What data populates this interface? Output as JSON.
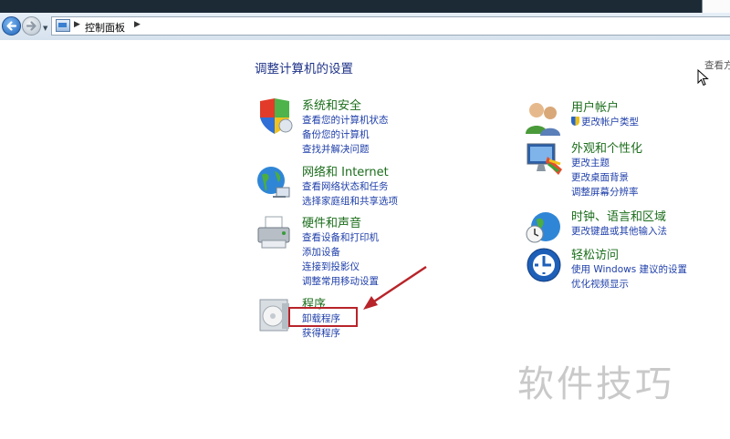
{
  "window": {
    "breadcrumb": "控制面板"
  },
  "main": {
    "heading": "调整计算机的设置",
    "view_by": "查看方式"
  },
  "categories": [
    {
      "title": "系统和安全",
      "icon": "shield-flag-icon",
      "links": [
        "查看您的计算机状态",
        "备份您的计算机",
        "查找并解决问题"
      ]
    },
    {
      "title": "网络和 Internet",
      "icon": "globe-network-icon",
      "links": [
        "查看网络状态和任务",
        "选择家庭组和共享选项"
      ]
    },
    {
      "title": "硬件和声音",
      "icon": "printer-icon",
      "links": [
        "查看设备和打印机",
        "添加设备",
        "连接到投影仪",
        "调整常用移动设置"
      ]
    },
    {
      "title": "程序",
      "icon": "programs-disc-icon",
      "links": [
        "卸载程序",
        "获得程序"
      ]
    },
    {
      "title": "用户帐户",
      "icon": "users-icon",
      "links": [
        "更改帐户类型"
      ]
    },
    {
      "title": "外观和个性化",
      "icon": "monitor-palette-icon",
      "links": [
        "更改主题",
        "更改桌面背景",
        "调整屏幕分辨率"
      ]
    },
    {
      "title": "时钟、语言和区域",
      "icon": "clock-globe-icon",
      "links": [
        "更改键盘或其他输入法"
      ]
    },
    {
      "title": "轻松访问",
      "icon": "accessibility-icon",
      "links": [
        "使用 Windows 建议的设置",
        "优化视频显示"
      ]
    }
  ],
  "annotation": {
    "highlighted_link": "卸载程序",
    "color": "#b8242a"
  },
  "watermark": "软件技巧",
  "colors": {
    "category_title": "#1b6d1b",
    "link": "#1f3faa",
    "heading": "#1e3287"
  }
}
